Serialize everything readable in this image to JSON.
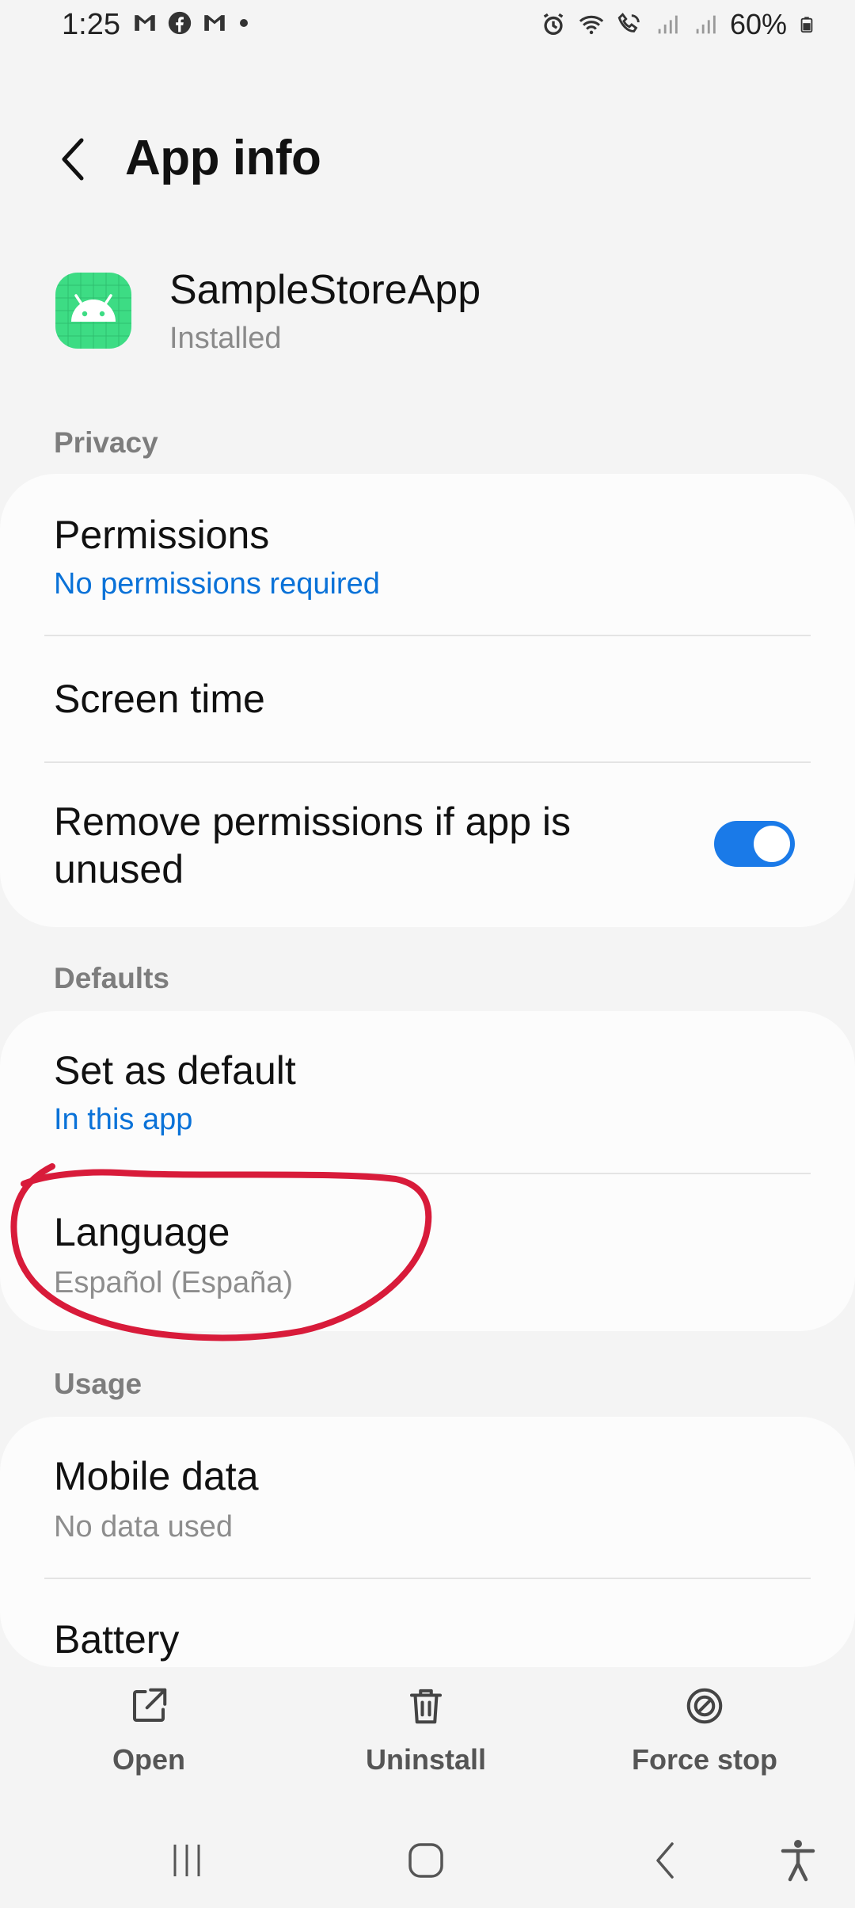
{
  "status_bar": {
    "time": "1:25",
    "battery": "60%",
    "left_icons": [
      "gmail-icon",
      "facebook-icon",
      "gmail-icon",
      "dot-icon"
    ],
    "right_icons": [
      "alarm-icon",
      "wifi-icon",
      "wifi-calling-icon",
      "signal-icon",
      "signal-icon",
      "battery-icon"
    ]
  },
  "header": {
    "title": "App info"
  },
  "app": {
    "name": "SampleStoreApp",
    "status": "Installed"
  },
  "privacy": {
    "label": "Privacy",
    "permissions": {
      "title": "Permissions",
      "subtitle": "No permissions required"
    },
    "screen_time": {
      "title": "Screen time"
    },
    "remove_permissions": {
      "title_line1": "Remove permissions if app is",
      "title_line2": "unused",
      "enabled": true
    }
  },
  "defaults": {
    "label": "Defaults",
    "set_as_default": {
      "title": "Set as default",
      "subtitle": "In this app"
    },
    "language": {
      "title": "Language",
      "subtitle": "Español (España)"
    }
  },
  "usage": {
    "label": "Usage",
    "mobile_data": {
      "title": "Mobile data",
      "subtitle": "No data used"
    },
    "battery": {
      "title": "Battery"
    }
  },
  "actions": {
    "open": "Open",
    "uninstall": "Uninstall",
    "force_stop": "Force stop"
  },
  "colors": {
    "accent": "#1a7ae8",
    "link": "#0a72d8",
    "annotation": "#d81b3a",
    "app_icon": "#3ddc84"
  }
}
